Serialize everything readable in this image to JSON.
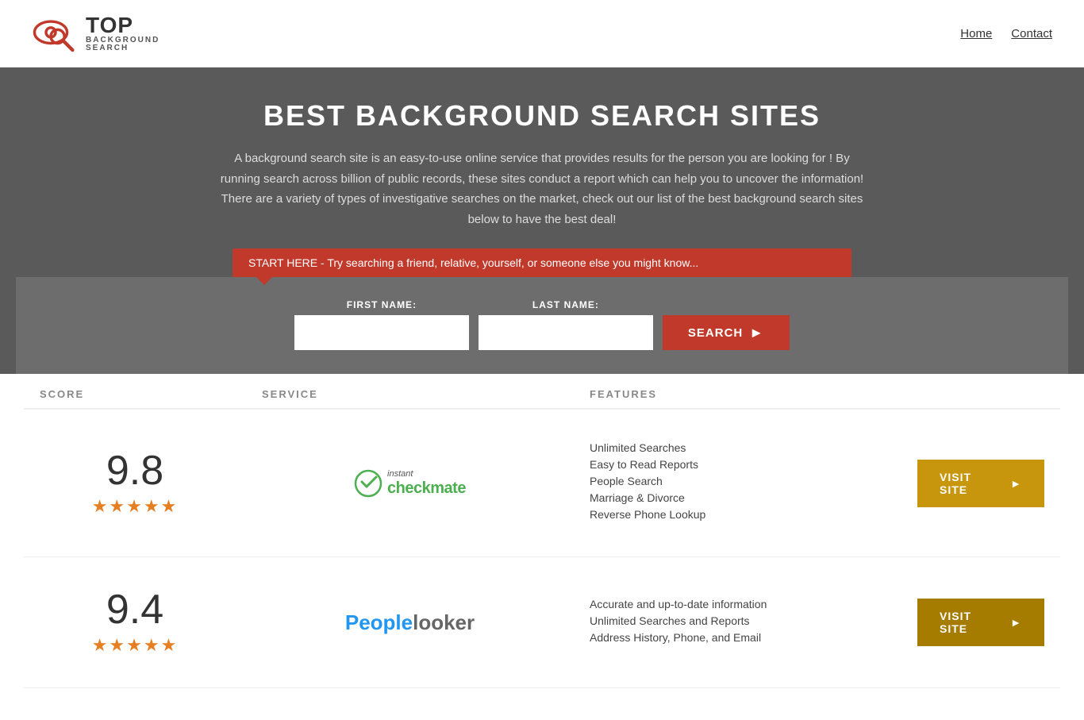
{
  "header": {
    "logo_top": "TOP",
    "logo_bottom": "BACKGROUND\nSEARCH",
    "nav": [
      {
        "label": "Home",
        "href": "#"
      },
      {
        "label": "Contact",
        "href": "#"
      }
    ]
  },
  "hero": {
    "title": "BEST BACKGROUND SEARCH SITES",
    "description": "A background search site is an easy-to-use online service that provides results  for the person you are looking for ! By  running  search across billion of public records, these sites conduct  a report which can help you to uncover the information! There are a variety of types of investigative searches on the market, check out our  list of the best background search sites below to have the best deal!",
    "banner_text": "START HERE - Try searching a friend, relative, yourself, or someone else you might know...",
    "first_name_label": "FIRST NAME:",
    "last_name_label": "LAST NAME:",
    "search_button": "SEARCH"
  },
  "table": {
    "headers": [
      "SCORE",
      "SERVICE",
      "FEATURES",
      ""
    ],
    "rows": [
      {
        "score": "9.8",
        "stars": "★★★★★",
        "service_name": "InstantCheckmate",
        "features": [
          "Unlimited Searches",
          "Easy to Read Reports",
          "People Search",
          "Marriage & Divorce",
          "Reverse Phone Lookup"
        ],
        "visit_label": "VISIT SITE"
      },
      {
        "score": "9.4",
        "stars": "★★★★★",
        "service_name": "PeopleLooker",
        "features": [
          "Accurate and up-to-date information",
          "Unlimited Searches and Reports",
          "Address History, Phone, and Email"
        ],
        "visit_label": "VISIT SITE"
      }
    ]
  }
}
